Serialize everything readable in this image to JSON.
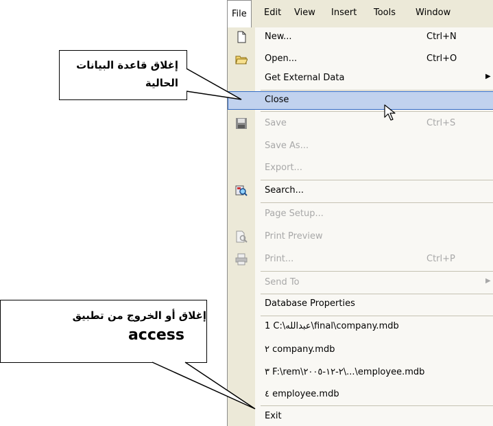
{
  "menubar": {
    "items": [
      {
        "label": "File"
      },
      {
        "label": "Edit"
      },
      {
        "label": "View"
      },
      {
        "label": "Insert"
      },
      {
        "label": "Tools"
      },
      {
        "label": "Window"
      }
    ]
  },
  "file_menu": {
    "items": [
      {
        "label": "New...",
        "shortcut": "Ctrl+N",
        "icon": "new-document-icon"
      },
      {
        "label": "Open...",
        "shortcut": "Ctrl+O",
        "icon": "open-folder-icon"
      },
      {
        "label": "Get External Data",
        "submenu": "▶"
      },
      {
        "label": "Close"
      },
      {
        "label": "Save",
        "shortcut": "Ctrl+S",
        "icon": "save-disk-icon"
      },
      {
        "label": "Save As..."
      },
      {
        "label": "Export..."
      },
      {
        "label": "Search...",
        "icon": "search-icon"
      },
      {
        "label": "Page Setup..."
      },
      {
        "label": "Print Preview",
        "icon": "print-preview-icon"
      },
      {
        "label": "Print...",
        "shortcut": "Ctrl+P",
        "icon": "printer-icon"
      },
      {
        "label": "Send To",
        "submenu": "▶"
      },
      {
        "label": "Database Properties"
      },
      {
        "label": "1 C:\\عبدالله\\final\\company.mdb"
      },
      {
        "label": "٢ company.mdb"
      },
      {
        "label": "٣ F:\\rem\\٢-١٢-٢٠٠٥\\...\\employee.mdb"
      },
      {
        "label": "٤ employee.mdb"
      },
      {
        "label": "Exit"
      }
    ]
  },
  "callouts": {
    "close_note": "إغلاق قاعدة البيانات الحالية",
    "exit_note_ar": "إغلاق أو الخروج من تطبيق",
    "exit_note_en": "access"
  },
  "colors": {
    "menubar_bg": "#ece9d8",
    "highlight_bg": "#c1d2ee",
    "highlight_border": "#316ac5",
    "disabled_text": "#a8a8a8"
  }
}
